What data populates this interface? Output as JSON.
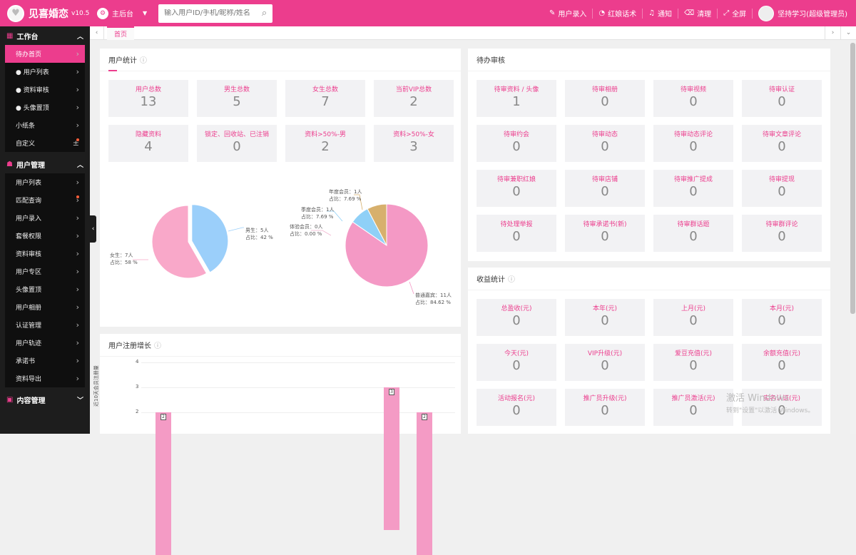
{
  "app": {
    "name": "见喜婚恋",
    "version": "v10.5"
  },
  "topbar": {
    "console_label": "主后台",
    "search_placeholder": "输入用户ID/手机/昵称/姓名",
    "actions": [
      {
        "icon": "edit-icon",
        "label": "用户录入"
      },
      {
        "icon": "chat-icon",
        "label": "红娘话术"
      },
      {
        "icon": "bell-icon",
        "label": "通知"
      },
      {
        "icon": "broom-icon",
        "label": "清理"
      },
      {
        "icon": "fullscreen-icon",
        "label": "全屏"
      }
    ],
    "user_label": "坚持学习(超级管理员)"
  },
  "sidebar": {
    "groups": [
      {
        "label": "工作台",
        "icon": "grid-icon",
        "items": [
          {
            "label": "待办首页",
            "active": true
          },
          {
            "label": "● 用户列表"
          },
          {
            "label": "● 资料审核"
          },
          {
            "label": "● 头像置顶"
          },
          {
            "label": "小纸条"
          },
          {
            "label": "自定义",
            "badge": "±"
          }
        ]
      },
      {
        "label": "用户管理",
        "icon": "user-icon",
        "items": [
          {
            "label": "用户列表"
          },
          {
            "label": "匹配查询",
            "dot": true
          },
          {
            "label": "用户录入"
          },
          {
            "label": "套餐权限"
          },
          {
            "label": "资料审核"
          },
          {
            "label": "用户专区"
          },
          {
            "label": "头像置顶"
          },
          {
            "label": "用户相册"
          },
          {
            "label": "认证管理"
          },
          {
            "label": "用户轨迹"
          },
          {
            "label": "承诺书"
          },
          {
            "label": "资料导出"
          }
        ]
      },
      {
        "label": "内容管理",
        "icon": "content-icon",
        "items": []
      }
    ]
  },
  "tabbar": {
    "home_label": "首页"
  },
  "user_stats": {
    "title": "用户统计",
    "tiles": [
      {
        "label": "用户总数",
        "value": "13"
      },
      {
        "label": "男生总数",
        "value": "5"
      },
      {
        "label": "女生总数",
        "value": "7"
      },
      {
        "label": "当前VIP总数",
        "value": "2"
      },
      {
        "label": "隐藏资料",
        "value": "4"
      },
      {
        "label": "锁定、回收站、已注销",
        "value": "0"
      },
      {
        "label": "资料>50%-男",
        "value": "2"
      },
      {
        "label": "资料>50%-女",
        "value": "3"
      }
    ]
  },
  "chart_data": [
    {
      "type": "pie",
      "labels": [
        "男生",
        "女生"
      ],
      "values": [
        5,
        7
      ],
      "percents": [
        "42 %",
        "58 %"
      ],
      "label_lines": [
        [
          "男生：5人",
          "占比：42 %"
        ],
        [
          "女生：7人",
          "占比：58 %"
        ]
      ],
      "colors": [
        "#9bcffa",
        "#f9a8c9"
      ]
    },
    {
      "type": "pie",
      "labels": [
        "普通嘉宾",
        "体验会员",
        "季度会员",
        "年度会员"
      ],
      "values": [
        11,
        0,
        1,
        1
      ],
      "percents": [
        "84.62 %",
        "0.00 %",
        "7.69 %",
        "7.69 %"
      ],
      "label_lines": [
        [
          "普通嘉宾：11人",
          "占比：84.62 %"
        ],
        [
          "体验会员：0人",
          "占比：0.00 %"
        ],
        [
          "季度会员：1人",
          "占比：7.69 %"
        ],
        [
          "年度会员：1人",
          "占比：7.69 %"
        ]
      ],
      "colors": [
        "#f499c5",
        "#f2b3d0",
        "#8fd0f7",
        "#d7b06d"
      ]
    },
    {
      "type": "bar",
      "title": "用户注册增长",
      "ylabel": "近10天会员注册量",
      "ylim": [
        0,
        4
      ],
      "yticks": [
        "4",
        "3",
        "2"
      ],
      "values": [
        2,
        3,
        2
      ],
      "value_labels": [
        "2",
        "3",
        "2"
      ],
      "color": "#f49bc5"
    }
  ],
  "pending": {
    "title": "待办审核",
    "tiles": [
      {
        "label": "待审资料 / 头像",
        "value": "1"
      },
      {
        "label": "待审相册",
        "value": "0"
      },
      {
        "label": "待审视频",
        "value": "0"
      },
      {
        "label": "待审认证",
        "value": "0"
      },
      {
        "label": "待审约会",
        "value": "0"
      },
      {
        "label": "待审动态",
        "value": "0"
      },
      {
        "label": "待审动态评论",
        "value": "0"
      },
      {
        "label": "待审文章评论",
        "value": "0"
      },
      {
        "label": "待审兼职红娘",
        "value": "0"
      },
      {
        "label": "待审店铺",
        "value": "0"
      },
      {
        "label": "待审推广提成",
        "value": "0"
      },
      {
        "label": "待审提现",
        "value": "0"
      },
      {
        "label": "待处理举报",
        "value": "0"
      },
      {
        "label": "待审承诺书(新)",
        "value": "0"
      },
      {
        "label": "待审群话题",
        "value": "0"
      },
      {
        "label": "待审群评论",
        "value": "0"
      }
    ]
  },
  "revenue": {
    "title": "收益统计",
    "tiles": [
      {
        "label": "总盈收(元)",
        "value": "0"
      },
      {
        "label": "本年(元)",
        "value": "0"
      },
      {
        "label": "上月(元)",
        "value": "0"
      },
      {
        "label": "本月(元)",
        "value": "0"
      },
      {
        "label": "今天(元)",
        "value": "0"
      },
      {
        "label": "VIP升级(元)",
        "value": "0"
      },
      {
        "label": "爱豆充值(元)",
        "value": "0"
      },
      {
        "label": "余额充值(元)",
        "value": "0"
      },
      {
        "label": "活动报名(元)",
        "value": "0"
      },
      {
        "label": "推广员升级(元)",
        "value": "0"
      },
      {
        "label": "推广员激活(元)",
        "value": "0"
      },
      {
        "label": "实名认证(元)",
        "value": "0"
      }
    ]
  },
  "watermark": {
    "line1": "激活 Windows",
    "line2": "转到\"设置\"以激活 Windows。"
  }
}
